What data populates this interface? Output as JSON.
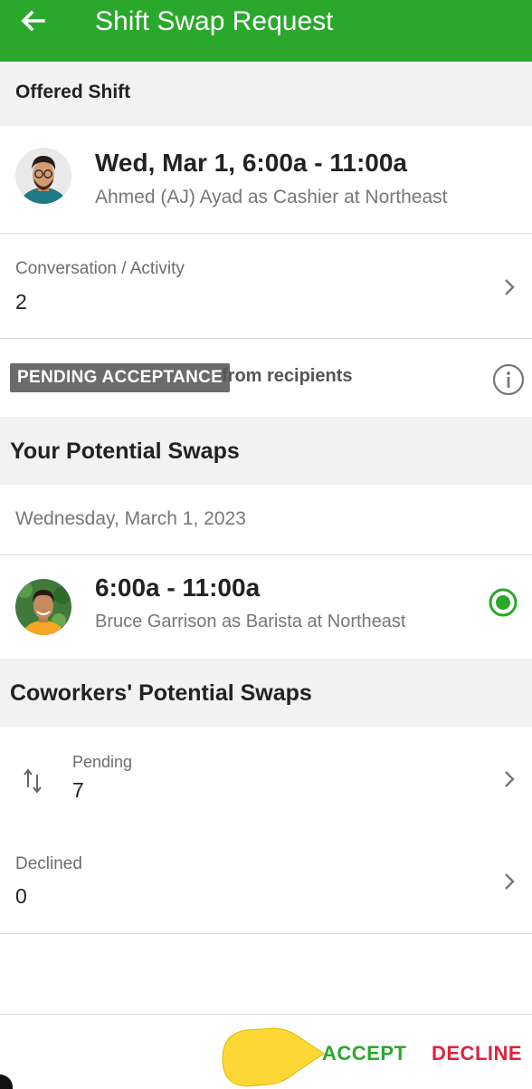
{
  "appbar": {
    "title": "Shift Swap Request",
    "back_icon": "arrow-left-icon"
  },
  "offered": {
    "section_title": "Offered Shift",
    "datetime": "Wed, Mar 1, 6:00a - 11:00a",
    "detail": "Ahmed (AJ) Ayad as Cashier at Northeast"
  },
  "conversation": {
    "label": "Conversation / Activity",
    "count": "2"
  },
  "status": {
    "badge": "PENDING ACCEPTANCE",
    "tail": "from recipients"
  },
  "your_swaps": {
    "section_title": "Your Potential Swaps",
    "date": "Wednesday, March 1, 2023",
    "time": "6:00a - 11:00a",
    "detail": "Bruce Garrison as Barista at Northeast"
  },
  "coworkers": {
    "section_title": "Coworkers' Potential Swaps",
    "pending_label": "Pending",
    "pending_count": "7",
    "declined_label": "Declined",
    "declined_count": "0"
  },
  "actions": {
    "accept": "ACCEPT",
    "decline": "DECLINE"
  },
  "colors": {
    "brand": "#2aa82c",
    "decline": "#e2213b",
    "badge": "#6b6b6b",
    "pointer": "#fdd835"
  }
}
